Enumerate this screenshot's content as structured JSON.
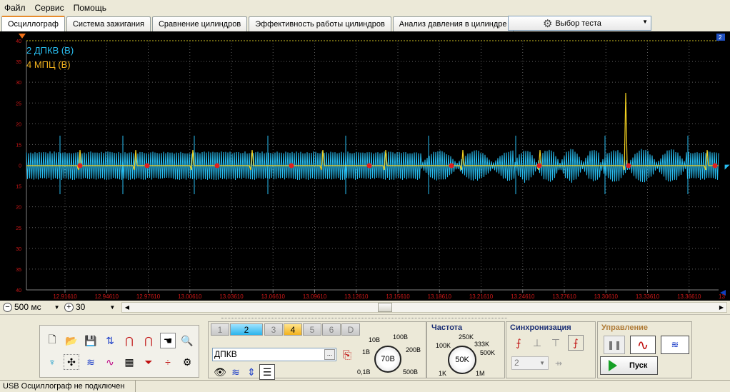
{
  "menu": [
    "Файл",
    "Сервис",
    "Помощь"
  ],
  "tabs": [
    {
      "label": "Осциллограф",
      "active": true
    },
    {
      "label": "Система зажигания"
    },
    {
      "label": "Сравнение цилиндров"
    },
    {
      "label": "Эффективность работы цилиндров"
    },
    {
      "label": "Анализ давления в цилиндре"
    }
  ],
  "test_select": {
    "label": "Выбор теста",
    "icon": "gear-icon"
  },
  "scope": {
    "legend": [
      {
        "label": "2 ДПКВ (В)",
        "color": "#28bdf0"
      },
      {
        "label": "4 МПЦ (В)",
        "color": "#f2b21e"
      }
    ],
    "y_ticks": [
      "40",
      "35",
      "30",
      "25",
      "20",
      "15",
      "0",
      "15",
      "20",
      "25",
      "30",
      "35",
      "40"
    ],
    "x_ticks": [
      "12.91610",
      "12.94610",
      "12.97610",
      "13.00610",
      "13.03610",
      "13.06610",
      "13.09610",
      "13.12610",
      "13.15610",
      "13.18610",
      "13.21610",
      "13.24610",
      "13.27610",
      "13.30610",
      "13.33610",
      "13.36610"
    ],
    "channel_marker": "2",
    "end_marker": "13",
    "grid_color": "#606060",
    "tick_color": "#d01818"
  },
  "scale": {
    "time_value": "500 мс",
    "zoom_value": "30",
    "minus": "−",
    "plus": "+"
  },
  "channels": {
    "buttons": [
      "1",
      "2",
      "3",
      "4",
      "5",
      "6",
      "D"
    ],
    "selected": "2",
    "active_secondary": "4",
    "name": "ДПКВ",
    "voltage_labels": [
      "10В",
      "100В",
      "1В",
      "200В",
      "0,1В",
      "500В"
    ],
    "voltage_value": "70В"
  },
  "frequency": {
    "title": "Частота",
    "labels": [
      "100K",
      "250K",
      "333K",
      "500K",
      "1K",
      "1M"
    ],
    "value": "50K"
  },
  "sync": {
    "title": "Синхронизация",
    "value": "2"
  },
  "control": {
    "title": "Управление",
    "start_label": "Пуск"
  },
  "status": {
    "text": "USB Осциллограф не подключен"
  }
}
